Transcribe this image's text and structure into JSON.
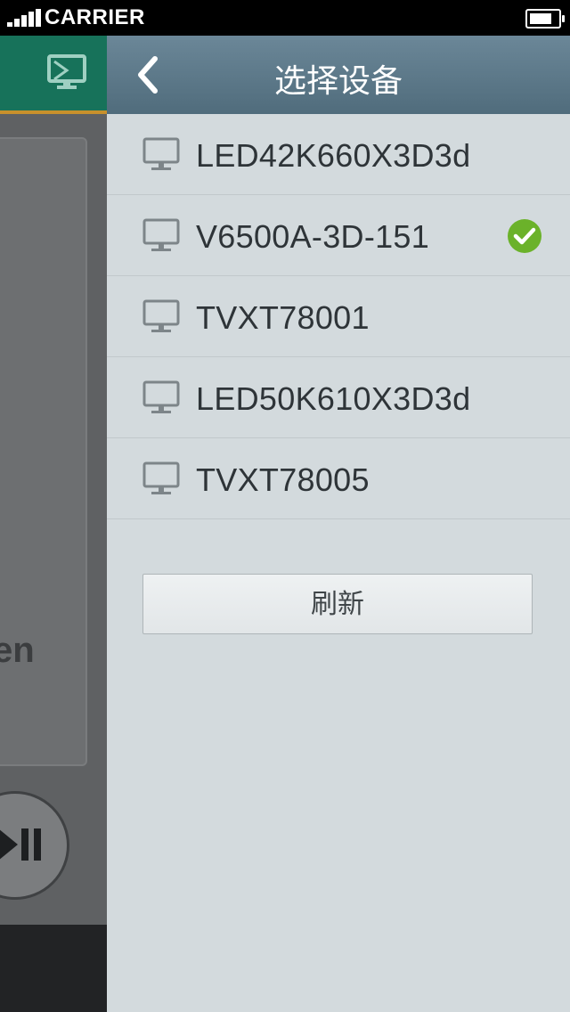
{
  "status_bar": {
    "carrier": "CARRIER",
    "battery_level": 0.85
  },
  "background_app": {
    "partial_text": "en"
  },
  "drawer": {
    "title": "选择设备",
    "devices": [
      {
        "name": "LED42K660X3D3d",
        "selected": false
      },
      {
        "name": "V6500A-3D-151",
        "selected": true
      },
      {
        "name": "TVXT78001",
        "selected": false
      },
      {
        "name": "LED50K610X3D3d",
        "selected": false
      },
      {
        "name": "TVXT78005",
        "selected": false
      }
    ],
    "refresh_label": "刷新"
  },
  "colors": {
    "nav_bar": "#5d7888",
    "drawer_bg": "#d3dadd",
    "check": "#6bb22a",
    "bg_header": "#17725a"
  },
  "icons": {
    "back": "chevron-left-icon",
    "device": "monitor-icon",
    "selected": "check-circle-icon",
    "cast": "screen-cast-icon",
    "play_pause": "play-pause-icon"
  }
}
